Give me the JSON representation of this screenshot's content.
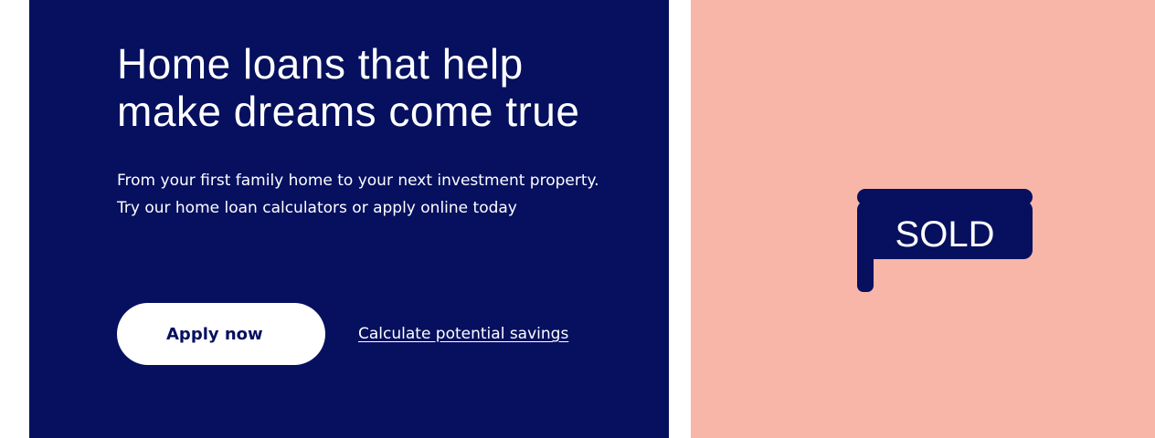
{
  "hero": {
    "title": "Home loans that help make dreams come true",
    "subtitle": "From your first family home to your next investment property. Try our home loan calculators or apply online today",
    "primary_cta": "Apply now",
    "secondary_link": "Calculate potential savings"
  },
  "illustration": {
    "sign_text": "SOLD",
    "background_color": "#f7b6a8",
    "sign_color": "#06105f"
  },
  "colors": {
    "brand_navy": "#06105f",
    "button_bg": "#ffffff"
  }
}
